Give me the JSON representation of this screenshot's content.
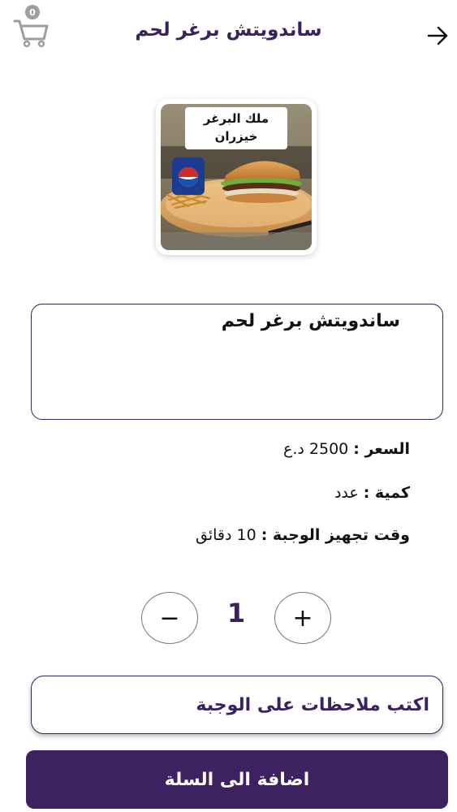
{
  "header": {
    "title": "ساندويتش برغر لحم",
    "cart_count": "0"
  },
  "product": {
    "image_label_line1": "ملك البرغر",
    "image_label_line2": "خيزران",
    "description": "ساندويتش برغر لحم"
  },
  "info": {
    "price_label": "السعر :",
    "price_value": "2500 د.ع",
    "quantity_label": "كمية :",
    "quantity_value": "عدد",
    "prep_label": "وقت تجهيز الوجبة :",
    "prep_value": "10 دقائق"
  },
  "stepper": {
    "minus_label": "−",
    "plus_label": "+",
    "value": "1"
  },
  "notes": {
    "placeholder": "اكتب ملاحظات على الوجبة"
  },
  "actions": {
    "add_to_cart_label": "اضافة الى السلة"
  },
  "colors": {
    "primary": "#3e2160",
    "title": "#3a2160",
    "badge": "#9e9e9e"
  }
}
